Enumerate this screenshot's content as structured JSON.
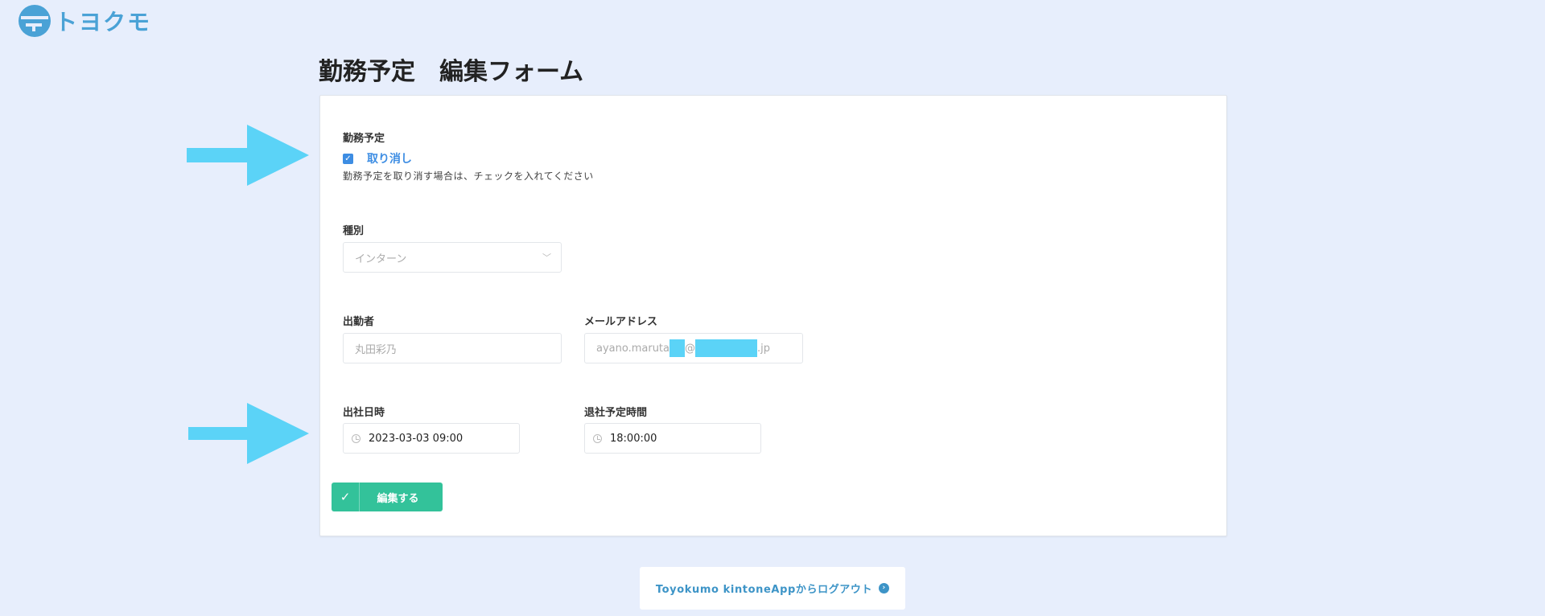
{
  "logo": {
    "text": "トヨクモ"
  },
  "page": {
    "title": "勤務予定　編集フォーム"
  },
  "form": {
    "schedule": {
      "label": "勤務予定",
      "checkbox_label": "取り消し",
      "checked": true,
      "help": "勤務予定を取り消す場合は、チェックを入れてください"
    },
    "type": {
      "label": "種別",
      "value": "インターン"
    },
    "worker": {
      "label": "出勤者",
      "value": "丸田彩乃"
    },
    "email": {
      "label": "メールアドレス",
      "value_prefix": "ayano.maruta",
      "at": "@",
      "value_suffix": ".jp"
    },
    "start": {
      "label": "出社日時",
      "value": "2023-03-03 09:00"
    },
    "end": {
      "label": "退社予定時間",
      "value": "18:00:00"
    },
    "submit": {
      "label": "編集する"
    }
  },
  "footer": {
    "logout_label": "Toyokumo kintoneAppからログアウト"
  },
  "colors": {
    "background": "#e7eefc",
    "accent_blue": "#3d8de3",
    "submit_green": "#33c29a",
    "annotation_arrow": "#5bd3f7"
  }
}
